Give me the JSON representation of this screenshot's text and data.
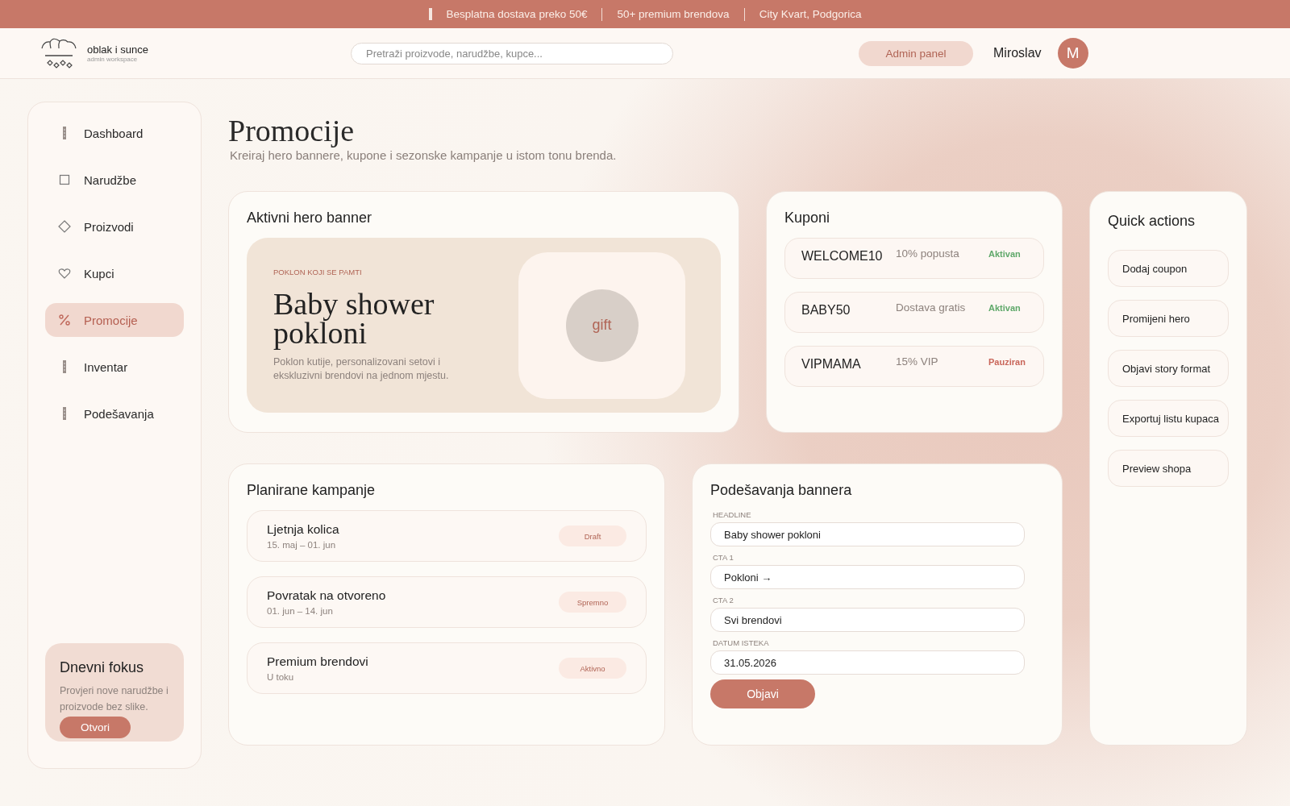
{
  "promo_bar": {
    "items": [
      "Besplatna dostava preko 50€",
      "50+ premium brendova",
      "City Kvart, Podgorica"
    ]
  },
  "header": {
    "brand": "oblak i sunce",
    "brand_sub": "admin workspace",
    "search": {
      "placeholder": "Pretraži proizvode, narudžbe, kupce..."
    },
    "admin_button": "Admin panel",
    "user": "Miroslav",
    "avatar": "M"
  },
  "sidebar": {
    "items": [
      {
        "label": "Dashboard",
        "kind": "bar",
        "selected": false
      },
      {
        "label": "Narudžbe",
        "kind": "square",
        "selected": false
      },
      {
        "label": "Proizvodi",
        "kind": "diamond",
        "selected": false
      },
      {
        "label": "Kupci",
        "kind": "heart",
        "selected": false
      },
      {
        "label": "Promocije",
        "kind": "percent",
        "selected": true
      },
      {
        "label": "Inventar",
        "kind": "bar",
        "selected": false
      },
      {
        "label": "Podešavanja",
        "kind": "bar",
        "selected": false
      }
    ],
    "focus": {
      "title": "Dnevni fokus",
      "text": "Provjeri nove narudžbe i proizvode bez slike.",
      "button": "Otvori"
    }
  },
  "page": {
    "title": "Promocije",
    "subtitle": "Kreiraj hero bannere, kupone i sezonske kampanje u istom tonu brenda."
  },
  "hero_banner": {
    "title": "Aktivni hero banner",
    "eyebrow": "POKLON KOJI SE PAMTI",
    "headline": "Baby shower pokloni",
    "text": "Poklon kutije, personalizovani setovi i ekskluzivni brendovi na jednom mjestu.",
    "image_label": "gift"
  },
  "coupons": {
    "title": "Kuponi",
    "items": [
      {
        "code": "WELCOME10",
        "desc": "10% popusta",
        "status": "Aktivan",
        "color": "#5fa86a"
      },
      {
        "code": "BABY50",
        "desc": "Dostava gratis",
        "status": "Aktivan",
        "color": "#5fa86a"
      },
      {
        "code": "VIPMAMA",
        "desc": "15% VIP",
        "status": "Pauziran",
        "color": "#c9665a"
      }
    ]
  },
  "quick_actions": {
    "title": "Quick actions",
    "items": [
      "Dodaj coupon",
      "Promijeni hero",
      "Objavi story format",
      "Exportuj listu kupaca",
      "Preview shopa"
    ]
  },
  "campaigns": {
    "title": "Planirane kampanje",
    "items": [
      {
        "name": "Ljetnja kolica",
        "dates": "15. maj – 01. jun",
        "status": "Draft"
      },
      {
        "name": "Povratak na otvoreno",
        "dates": "01. jun – 14. jun",
        "status": "Spremno"
      },
      {
        "name": "Premium brendovi",
        "dates": "U toku",
        "status": "Aktivno"
      }
    ]
  },
  "banner_settings": {
    "title": "Podešavanja bannera",
    "fields": [
      {
        "label": "HEADLINE",
        "value": "Baby shower pokloni"
      },
      {
        "label": "CTA 1",
        "value": "Pokloni →"
      },
      {
        "label": "CTA 2",
        "value": "Svi brendovi"
      },
      {
        "label": "DATUM ISTEKA",
        "value": "31.05.2026"
      }
    ],
    "button": "Objavi"
  }
}
